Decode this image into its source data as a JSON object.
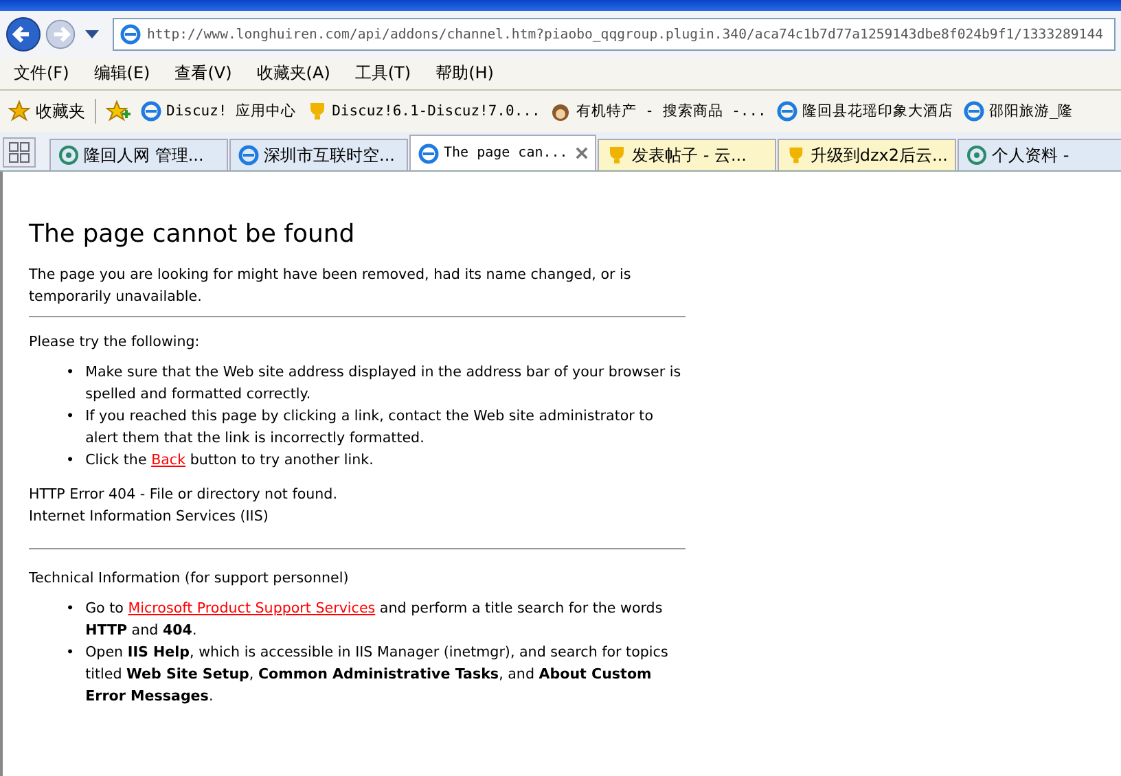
{
  "address_bar": {
    "url": "http://www.longhuiren.com/api/addons/channel.htm?piaobo_qqgroup.plugin.340/aca74c1b7d77a1259143dbe8f024b9f1/1333289144"
  },
  "menu": [
    "文件(F)",
    "编辑(E)",
    "查看(V)",
    "收藏夹(A)",
    "工具(T)",
    "帮助(H)"
  ],
  "favorites": {
    "label": "收藏夹",
    "items": [
      {
        "label": "Discuz! 应用中心",
        "kind": "ie"
      },
      {
        "label": "Discuz!6.1-Discuz!7.0...",
        "kind": "trophy"
      },
      {
        "label": "有机特产 - 搜索商品 -...",
        "kind": "mascot"
      },
      {
        "label": "隆回县花瑶印象大酒店",
        "kind": "ie"
      },
      {
        "label": "邵阳旅游_隆",
        "kind": "ie"
      }
    ]
  },
  "tabs": [
    {
      "label": "隆回人网 管理...",
      "kind": "eye",
      "selected": false
    },
    {
      "label": "深圳市互联时空...",
      "kind": "ie",
      "selected": false
    },
    {
      "label": "The page can...",
      "kind": "ie",
      "selected": true
    },
    {
      "label": "发表帖子 - 云...",
      "kind": "trophy",
      "selected": false
    },
    {
      "label": "升级到dzx2后云...",
      "kind": "trophy",
      "selected": false
    },
    {
      "label": "个人资料 -",
      "kind": "eye",
      "selected": false
    }
  ],
  "page": {
    "title": "The page cannot be found",
    "intro": "The page you are looking for might have been removed, had its name changed, or is temporarily unavailable.",
    "bullet": "•",
    "try_heading": "Please try the following:",
    "try_items": [
      {
        "before": "Make sure that the Web site address displayed in the address bar of your browser is spelled and formatted correctly."
      },
      {
        "before": "If you reached this page by clicking a link, contact the Web site administrator to alert them that the link is incorrectly formatted."
      },
      {
        "before": "Click the ",
        "link": "Back",
        "after": " button to try another link."
      }
    ],
    "error": "HTTP Error 404 - File or directory not found.",
    "server": "Internet Information Services (IIS)",
    "tech_heading": "Technical Information (for support personnel)",
    "tech_items": [
      {
        "before": "Go to ",
        "link": "Microsoft Product Support Services",
        "after": " and perform a title search for the words **HTTP** and **404**."
      },
      {
        "before": "Open **IIS Help**, which is accessible in IIS Manager (inetmgr), and search for topics titled **Web Site Setup**, **Common Administrative Tasks**, and **About Custom Error Messages**."
      }
    ]
  }
}
